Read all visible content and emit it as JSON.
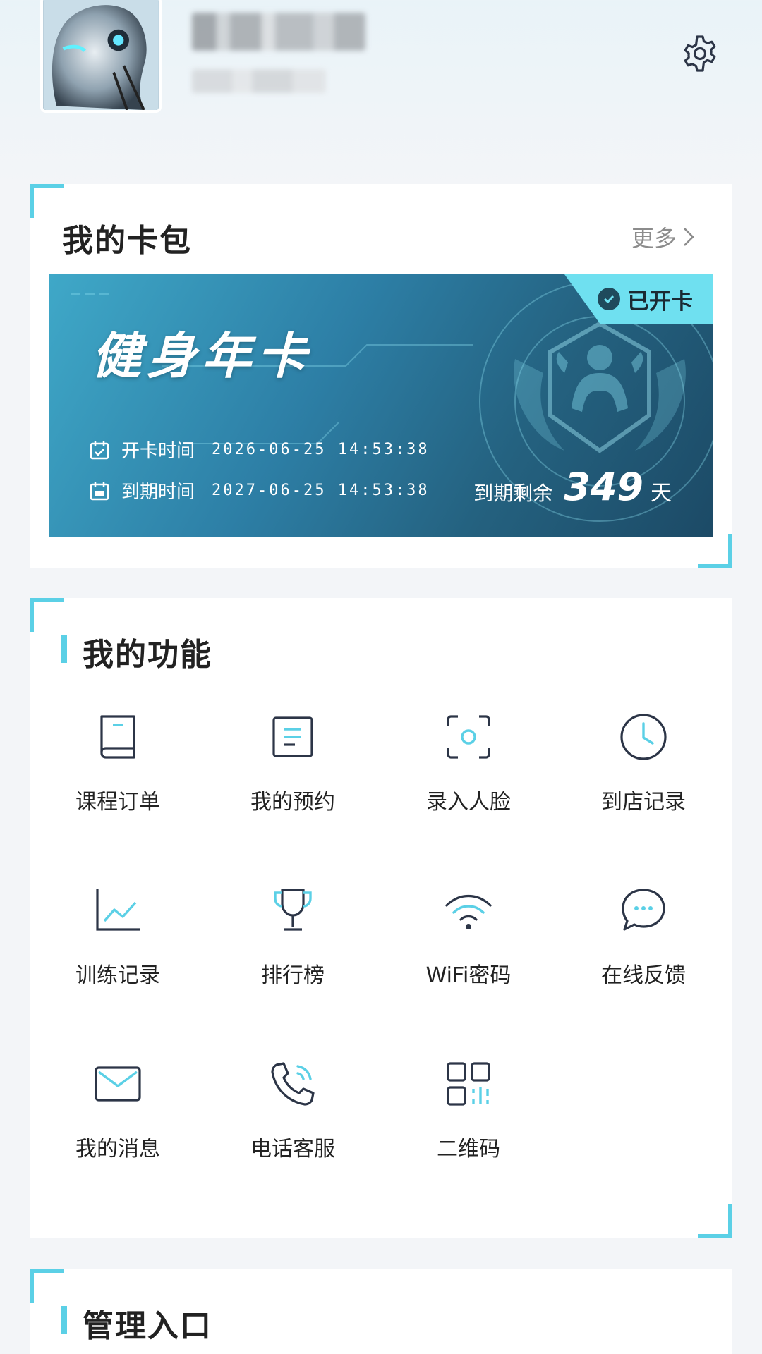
{
  "wallet": {
    "title": "我的卡包",
    "more_label": "更多",
    "card": {
      "name": "健身年卡",
      "status": "已开卡",
      "open_label": "开卡时间",
      "open_time": "2026-06-25 14:53:38",
      "expire_label": "到期时间",
      "expire_time": "2027-06-25 14:53:38",
      "remain_label": "到期剩余",
      "remain_days": "349",
      "remain_unit": "天"
    }
  },
  "features": {
    "title": "我的功能",
    "items": [
      {
        "label": "课程订单",
        "icon": "book-icon"
      },
      {
        "label": "我的预约",
        "icon": "document-icon"
      },
      {
        "label": "录入人脸",
        "icon": "face-scan-icon"
      },
      {
        "label": "到店记录",
        "icon": "clock-icon"
      },
      {
        "label": "训练记录",
        "icon": "chart-icon"
      },
      {
        "label": "排行榜",
        "icon": "trophy-icon"
      },
      {
        "label": "WiFi密码",
        "icon": "wifi-icon"
      },
      {
        "label": "在线反馈",
        "icon": "chat-icon"
      },
      {
        "label": "我的消息",
        "icon": "mail-icon"
      },
      {
        "label": "电话客服",
        "icon": "phone-icon"
      },
      {
        "label": "二维码",
        "icon": "qrcode-icon"
      }
    ]
  },
  "admin": {
    "title": "管理入口"
  },
  "colors": {
    "accent": "#5bd0e6",
    "icon_stroke": "#2c3547"
  }
}
